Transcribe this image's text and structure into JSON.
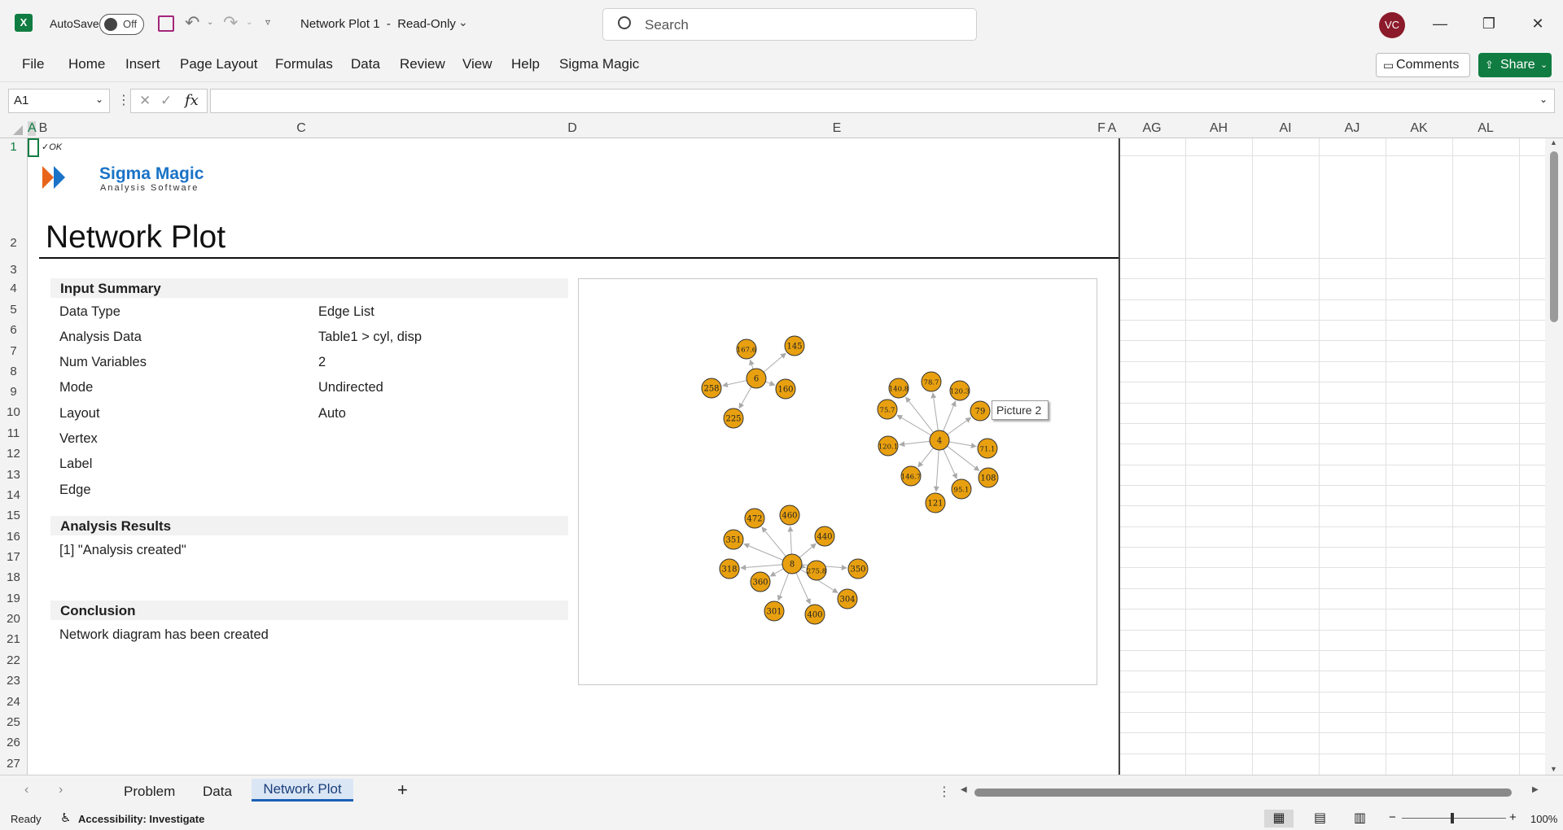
{
  "titlebar": {
    "autosave_label": "AutoSave",
    "autosave_state": "Off",
    "doc_title": "Network Plot 1  -  Read-Only",
    "search_placeholder": "Search",
    "user_initials": "VC"
  },
  "menu": {
    "items": [
      "File",
      "Home",
      "Insert",
      "Page Layout",
      "Formulas",
      "Data",
      "Review",
      "View",
      "Help",
      "Sigma Magic"
    ],
    "comments_label": "Comments",
    "share_label": "Share"
  },
  "formula_bar": {
    "name_box": "A1",
    "fx_label": "fx",
    "formula": ""
  },
  "columns_left": [
    "A",
    "B",
    "C",
    "D",
    "E",
    "F",
    "A"
  ],
  "columns_right": [
    "AG",
    "AH",
    "AI",
    "AJ",
    "AK",
    "AL"
  ],
  "rows": [
    "1",
    "2",
    "3",
    "4",
    "5",
    "6",
    "7",
    "8",
    "9",
    "10",
    "11",
    "12",
    "13",
    "14",
    "15",
    "16",
    "17",
    "18",
    "19",
    "20",
    "21",
    "22",
    "23",
    "24",
    "25",
    "26",
    "27"
  ],
  "sheet": {
    "ok_mark": "✓OK",
    "logo_name": "Sigma Magic",
    "logo_tagline": "Analysis Software",
    "title": "Network Plot",
    "input_summary_header": "Input Summary",
    "input_rows": [
      {
        "label": "Data Type",
        "value": "Edge List"
      },
      {
        "label": "Analysis Data",
        "value": "Table1 > cyl, disp"
      },
      {
        "label": "Num Variables",
        "value": "2"
      },
      {
        "label": "Mode",
        "value": "Undirected"
      },
      {
        "label": "Layout",
        "value": "Auto"
      },
      {
        "label": "Vertex",
        "value": ""
      },
      {
        "label": "Label",
        "value": ""
      },
      {
        "label": "Edge",
        "value": ""
      }
    ],
    "results_header": "Analysis Results",
    "results_text": "[1] \"Analysis created\"",
    "conclusion_header": "Conclusion",
    "conclusion_text": "Network diagram has been created",
    "picture_tooltip": "Picture 2"
  },
  "network": {
    "node_color": "#e8a010",
    "edge_color": "#aaaaaa",
    "clusters": [
      {
        "hub": "6",
        "leaves": [
          "167.6",
          "145",
          "258",
          "160",
          "225"
        ]
      },
      {
        "hub": "4",
        "leaves": [
          "140.8",
          "78.7",
          "120.3",
          "75.7",
          "79",
          "120.1",
          "71.1",
          "146.7",
          "108",
          "95.1",
          "121"
        ]
      },
      {
        "hub": "8",
        "leaves": [
          "472",
          "460",
          "440",
          "351",
          "318",
          "360",
          "275.8",
          "350",
          "304",
          "301",
          "400"
        ]
      }
    ]
  },
  "tabs": {
    "items": [
      "Problem",
      "Data",
      "Network Plot"
    ],
    "active": "Network Plot",
    "add_label": "+"
  },
  "status": {
    "ready": "Ready",
    "accessibility": "Accessibility: Investigate",
    "zoom": "100%"
  }
}
